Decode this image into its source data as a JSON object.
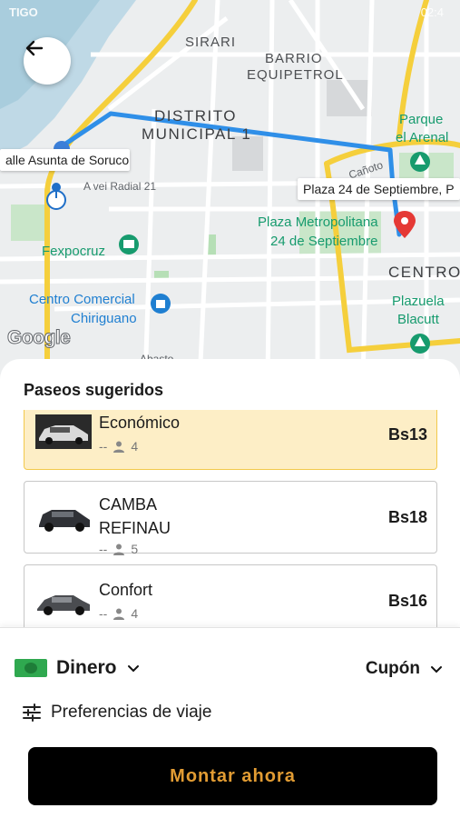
{
  "status_bar": {
    "carrier": "TIGO",
    "time": "02:4"
  },
  "map": {
    "labels": {
      "sirari": "SIRARI",
      "barrio": "BARRIO",
      "equipetrol": "EQUIPETROL",
      "distrito": "DISTRITO",
      "municipal": "MUNICIPAL 1",
      "centro": "CENTRO"
    },
    "pois": {
      "parque": "Parque",
      "arenal": "el Arenal",
      "plaza_metro_1": "Plaza Metropolitana",
      "plaza_metro_2": "24 de Septiembre",
      "fexpocruz": "Fexpocruz",
      "comercial_1": "Centro Comercial",
      "comercial_2": "Chiriguano",
      "plazuela_1": "Plazuela",
      "plazuela_2": "Blacutt",
      "radial": "A vei Radial 21",
      "canoto": "Cañoto",
      "abasto": "Abasto"
    },
    "origin_label": "alle Asunta de Soruco",
    "destination_label": "Plaza 24 de Septiembre, P",
    "google": "Google"
  },
  "sheet": {
    "title": "Paseos sugeridos",
    "rides": [
      {
        "name": "Económico",
        "eta": "--",
        "seats": "4",
        "price": "Bs13",
        "selected": true
      },
      {
        "name_line1": "CAMBA",
        "name_line2": "REFINAU",
        "eta": "--",
        "seats": "5",
        "price": "Bs18",
        "selected": false
      },
      {
        "name": "Confort",
        "eta": "--",
        "seats": "4",
        "price": "Bs16",
        "selected": false
      }
    ]
  },
  "payment": {
    "method": "Dinero",
    "coupon": "Cupón"
  },
  "preferences": {
    "label": "Preferencias de viaje"
  },
  "cta": {
    "label": "Montar ahora"
  },
  "colors": {
    "route": "#2f8fe8",
    "main_road": "#f5cf3c",
    "selected_bg": "#fdeec6",
    "cta_bg": "#000000",
    "cta_text": "#e29c33",
    "poi_green": "#179b6e",
    "poi_blue": "#1f7fd1"
  }
}
